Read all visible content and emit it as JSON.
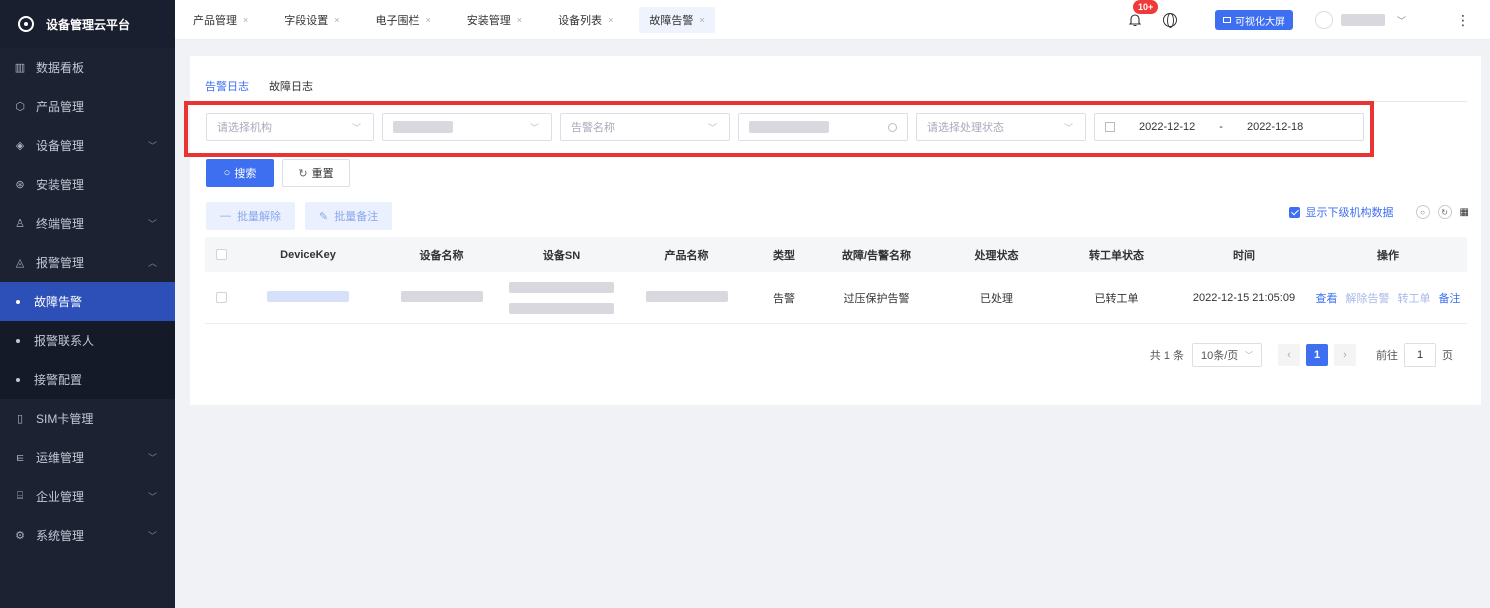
{
  "app": {
    "brand": "设备管理云平台"
  },
  "sidebar": {
    "items": [
      {
        "label": "数据看板",
        "icon": "bar-chart-icon",
        "has_children": false
      },
      {
        "label": "产品管理",
        "icon": "cube-icon",
        "has_children": false
      },
      {
        "label": "设备管理",
        "icon": "layers-icon",
        "has_children": true
      },
      {
        "label": "安装管理",
        "icon": "tool-icon",
        "has_children": false
      },
      {
        "label": "终端管理",
        "icon": "user-icon",
        "has_children": true
      },
      {
        "label": "报警管理",
        "icon": "alarm-icon",
        "has_children": true,
        "expanded": true
      },
      {
        "label": "故障告警",
        "sub": true,
        "active": true
      },
      {
        "label": "报警联系人",
        "sub": true
      },
      {
        "label": "接警配置",
        "sub": true
      },
      {
        "label": "SIM卡管理",
        "icon": "sim-icon",
        "has_children": false
      },
      {
        "label": "运维管理",
        "icon": "wrench-icon",
        "has_children": true
      },
      {
        "label": "企业管理",
        "icon": "building-icon",
        "has_children": true
      },
      {
        "label": "系统管理",
        "icon": "gear-icon",
        "has_children": true
      }
    ]
  },
  "topbar": {
    "tabs": [
      {
        "label": "产品管理"
      },
      {
        "label": "字段设置"
      },
      {
        "label": "电子围栏"
      },
      {
        "label": "安装管理"
      },
      {
        "label": "设备列表"
      },
      {
        "label": "故障告警",
        "active": true
      }
    ],
    "close_glyph": "×",
    "notification_badge": "10+",
    "visual_screen_label": "可视化大屏"
  },
  "page": {
    "subtabs": [
      {
        "label": "告警日志",
        "active": true
      },
      {
        "label": "故障日志"
      }
    ],
    "filters": {
      "org_placeholder": "请选择机构",
      "alarm_name_placeholder": "告警名称",
      "status_placeholder": "请选择处理状态",
      "date_start": "2022-12-12",
      "date_sep": "-",
      "date_end": "2022-12-18"
    },
    "buttons": {
      "search": "搜索",
      "reset": "重置",
      "batch_release": "批量解除",
      "batch_note": "批量备注"
    },
    "show_sub_org": "显示下级机构数据",
    "table": {
      "headers": [
        "DeviceKey",
        "设备名称",
        "设备SN",
        "产品名称",
        "类型",
        "故障/告警名称",
        "处理状态",
        "转工单状态",
        "时间",
        "操作"
      ],
      "rows": [
        {
          "type": "告警",
          "alarm_name": "过压保护告警",
          "status": "已处理",
          "order_status": "已转工单",
          "time": "2022-12-15 21:05:09",
          "ops": {
            "view": "查看",
            "release": "解除告警",
            "to_order": "转工单",
            "note": "备注"
          }
        }
      ]
    },
    "pagination": {
      "total": "共 1 条",
      "page_size": "10条/页",
      "current": "1",
      "goto_label": "前往",
      "goto_value": "1",
      "page_suffix": "页"
    }
  },
  "colors": {
    "primary": "#3e6ff0",
    "sidebar_bg": "#1d2233",
    "highlight": "#e93434"
  }
}
